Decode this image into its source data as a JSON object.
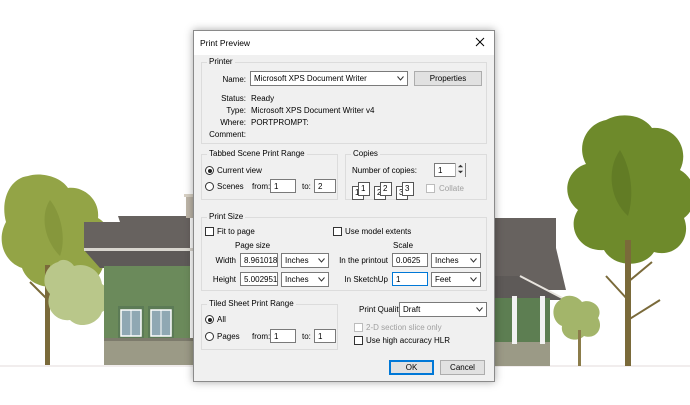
{
  "dialog": {
    "title": "Print Preview",
    "printer": {
      "legend": "Printer",
      "name_label": "Name:",
      "name_value": "Microsoft XPS Document Writer",
      "properties_label": "Properties",
      "status_label": "Status:",
      "status_value": "Ready",
      "type_label": "Type:",
      "type_value": "Microsoft XPS Document Writer v4",
      "where_label": "Where:",
      "where_value": "PORTPROMPT:",
      "comment_label": "Comment:"
    },
    "scene_range": {
      "legend": "Tabbed Scene Print Range",
      "current_view_label": "Current view",
      "scenes_label": "Scenes",
      "from_label": "from:",
      "from_value": "1",
      "to_label": "to:",
      "to_value": "2"
    },
    "copies": {
      "legend": "Copies",
      "number_label": "Number of copies:",
      "number_value": "1",
      "collate_label": "Collate",
      "collate_icon_numbers": [
        "1",
        "1",
        "2",
        "2",
        "3",
        "3"
      ]
    },
    "print_size": {
      "legend": "Print Size",
      "fit_to_page_label": "Fit to page",
      "use_model_extents_label": "Use model extents",
      "page_size_heading": "Page size",
      "width_label": "Width",
      "width_value": "8.961018",
      "width_unit": "Inches",
      "height_label": "Height",
      "height_value": "5.002951",
      "height_unit": "Inches",
      "scale_heading": "Scale",
      "printout_label": "In the printout",
      "printout_value": "0.0625",
      "printout_unit": "Inches",
      "sketchup_label": "In SketchUp",
      "sketchup_value": "1",
      "sketchup_unit": "Feet"
    },
    "tiled_range": {
      "legend": "Tiled Sheet Print Range",
      "all_label": "All",
      "pages_label": "Pages",
      "from_label": "from:",
      "from_value": "1",
      "to_label": "to:",
      "to_value": "1"
    },
    "quality": {
      "label": "Print Quality",
      "value": "Draft",
      "section_slice_label": "2-D section slice only",
      "hlr_label": "Use high accuracy HLR"
    },
    "ok_label": "OK",
    "cancel_label": "Cancel"
  },
  "colors": {
    "dialog_bg": "#f0f0f0",
    "focus_blue": "#0078d7",
    "tree_green": "#6f8a2c",
    "roof_gray": "#5e5a58",
    "siding_green": "#5d7e52"
  }
}
